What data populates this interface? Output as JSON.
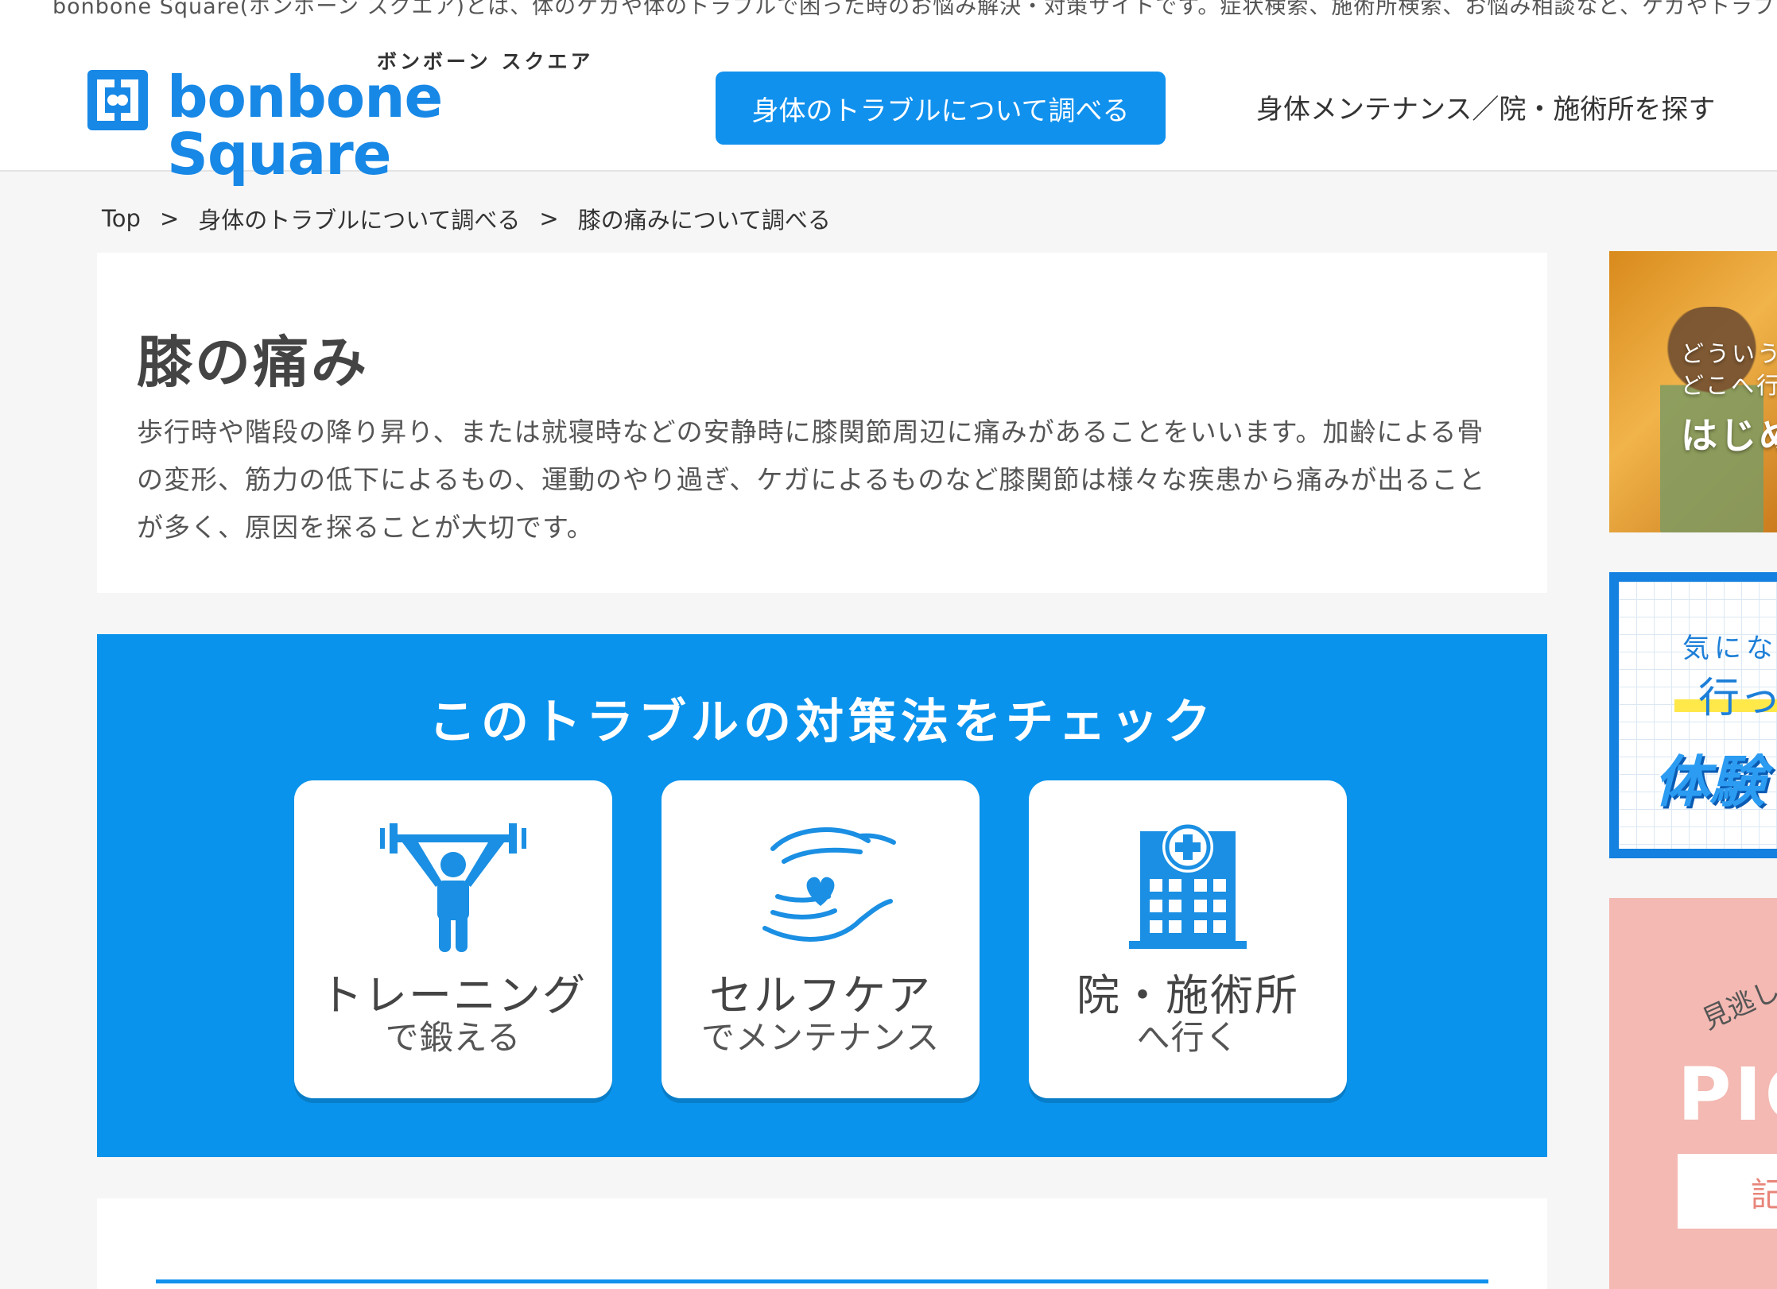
{
  "site": {
    "tagline": "bonbone Square(ボンボーン スクエア)とは、体のケガや体のトラブルで困った時のお悩み解決・対策サイトです。症状検索、施術所検索、お悩み相談など、ケガやトラブルでお",
    "logo_kana": "ボンボーン スクエア",
    "logo_text": "bonbone Square",
    "brand_color": "#1888e6"
  },
  "nav": {
    "primary_label": "身体のトラブルについて調べる",
    "secondary_label": "身体メンテナンス／院・施術所を探す"
  },
  "breadcrumb": {
    "items": [
      "Top",
      "身体のトラブルについて調べる",
      "膝の痛みについて調べる"
    ],
    "separator": ">"
  },
  "intro": {
    "title": "膝の痛み",
    "description": "歩行時や階段の降り昇り、または就寝時などの安静時に膝関節周辺に痛みがあることをいいます。加齢による骨の変形、筋力の低下によるもの、運動のやり過ぎ、ケガによるものなど膝関節は様々な疾患から痛みが出ることが多く、原因を探ることが大切です。"
  },
  "check": {
    "title": "このトラブルの対策法をチェック",
    "accent_color": "#0a93ec",
    "cards": [
      {
        "icon": "weightlifting-icon",
        "main": "トレーニング",
        "sub": "で鍛える"
      },
      {
        "icon": "hands-heart-icon",
        "main": "セルフケア",
        "sub": "でメンテナンス"
      },
      {
        "icon": "hospital-icon",
        "main": "院・施術所",
        "sub": "へ行く"
      }
    ]
  },
  "side_banners": {
    "photo": {
      "line1": "どういう",
      "line2": "どこへ行",
      "line3": "はじめ"
    },
    "grid": {
      "line1": "気になる",
      "line2": "行っ",
      "line3": "体験"
    },
    "pink": {
      "line1": "見逃した",
      "line2": "PIC",
      "line3": "記"
    }
  }
}
